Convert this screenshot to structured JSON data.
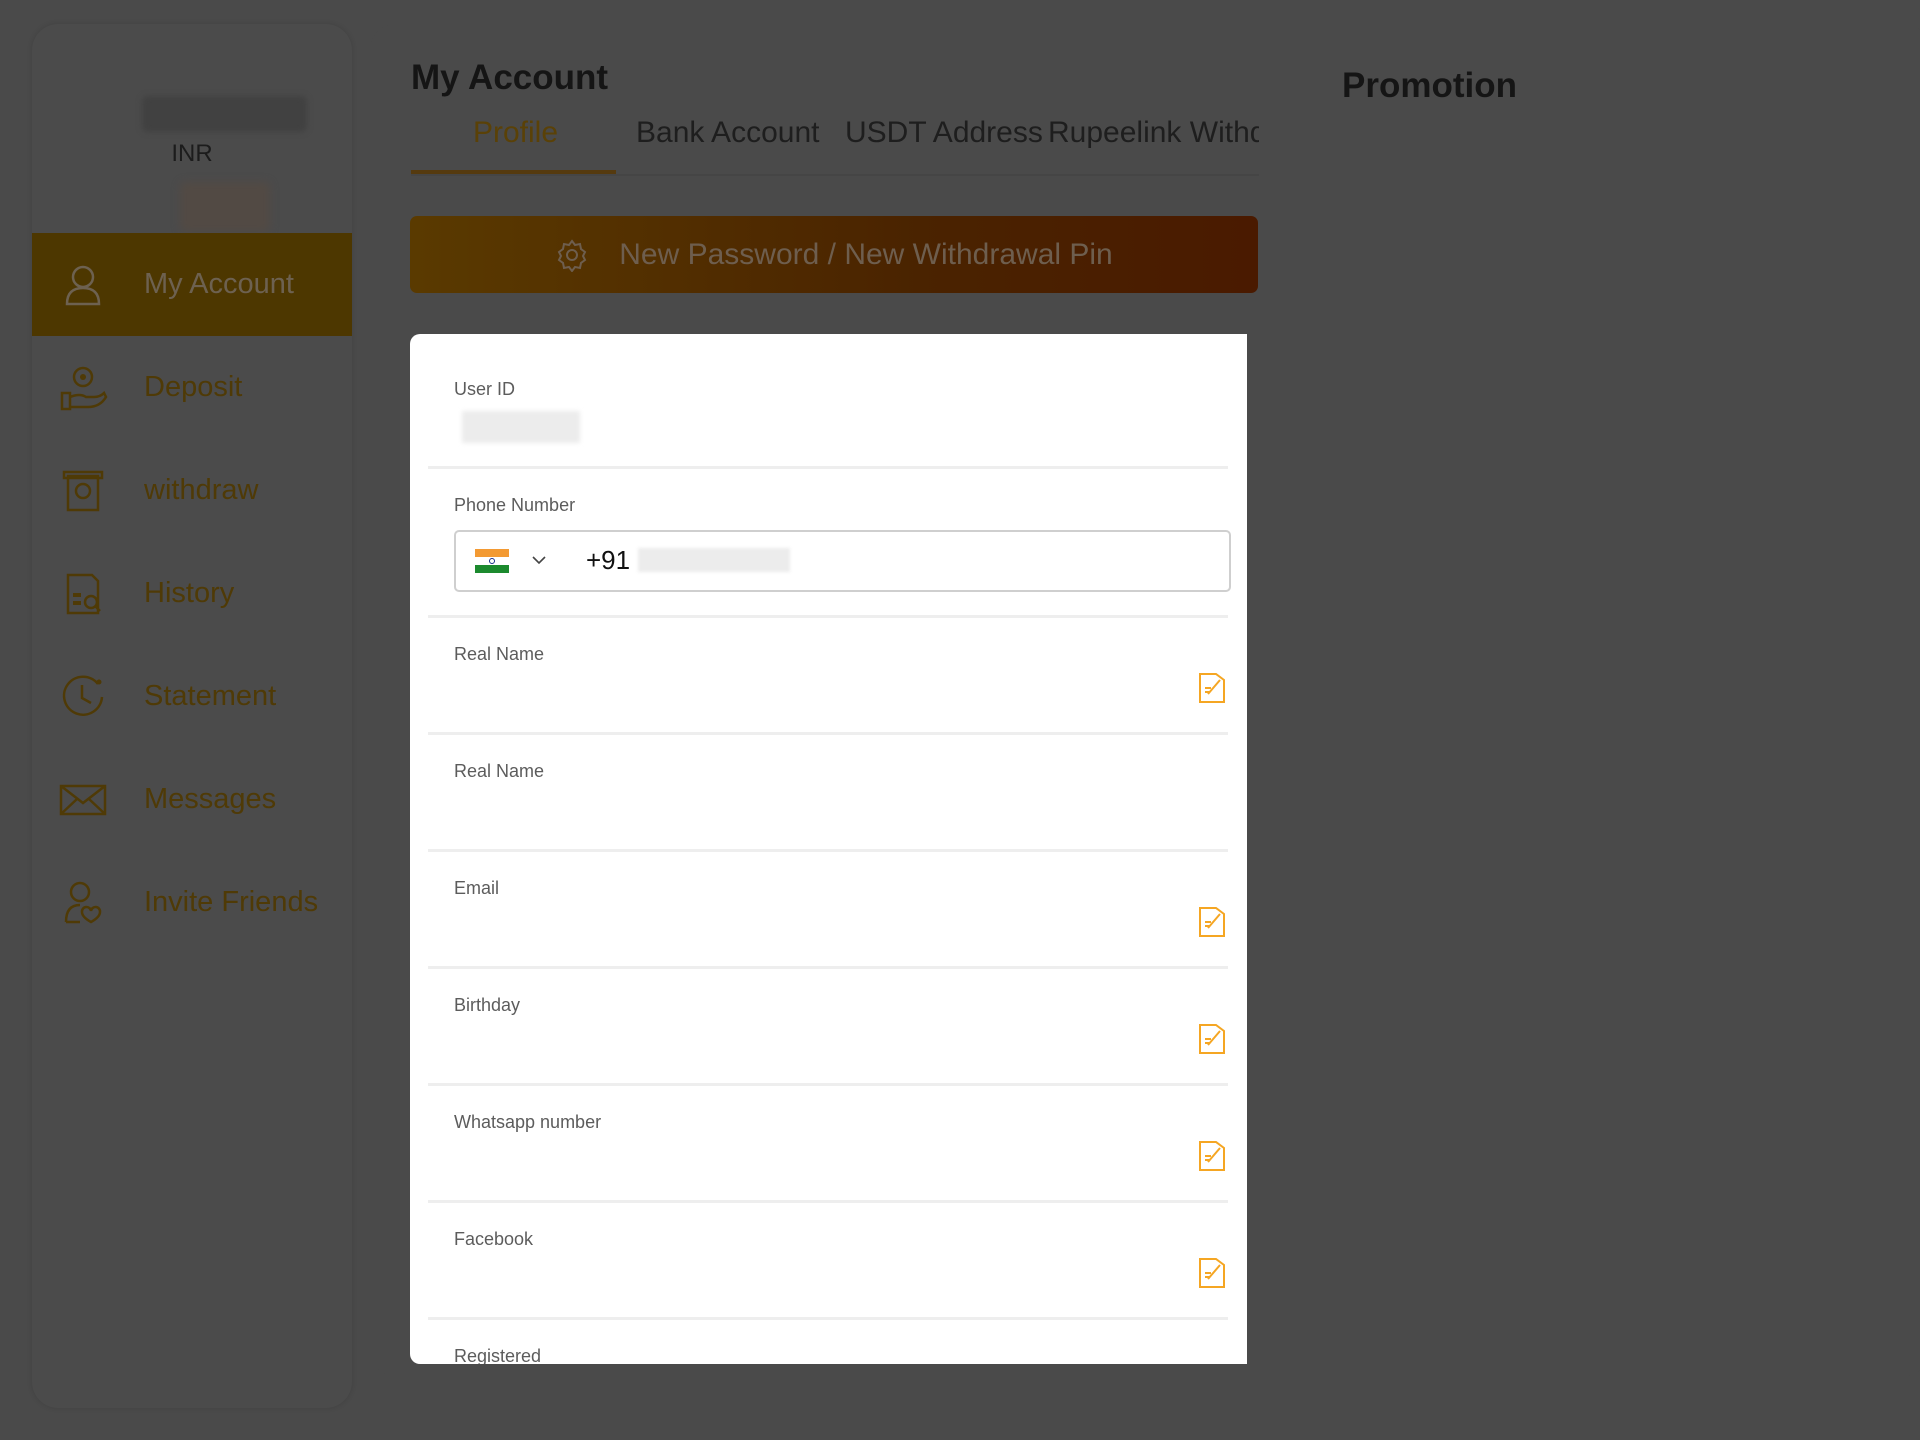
{
  "sidebar": {
    "currency": "INR",
    "items": [
      {
        "label": "My Account",
        "icon": "user-icon",
        "active": true
      },
      {
        "label": "Deposit",
        "icon": "deposit-icon",
        "active": false
      },
      {
        "label": "withdraw",
        "icon": "withdraw-icon",
        "active": false
      },
      {
        "label": "History",
        "icon": "history-icon",
        "active": false
      },
      {
        "label": "Statement",
        "icon": "clock-icon",
        "active": false
      },
      {
        "label": "Messages",
        "icon": "envelope-icon",
        "active": false
      },
      {
        "label": "Invite Friends",
        "icon": "invite-user-icon",
        "active": false
      }
    ]
  },
  "header": {
    "title": "My Account",
    "tabs": [
      {
        "label": "Profile",
        "active": true
      },
      {
        "label": "Bank Account",
        "active": false
      },
      {
        "label": "USDT Address",
        "active": false
      },
      {
        "label": "Rupeelink Withdraw",
        "active": false
      }
    ]
  },
  "password_button": {
    "label": "New Password / New Withdrawal Pin",
    "icon": "gear-icon"
  },
  "promotion": {
    "title": "Promotion"
  },
  "profile": {
    "user_id": {
      "label": "User ID"
    },
    "phone": {
      "label": "Phone Number",
      "country_code": "+91",
      "country": "India"
    },
    "fields": [
      {
        "label": "Real Name",
        "editable": true
      },
      {
        "label": "Real Name",
        "editable": false
      },
      {
        "label": "Email",
        "editable": true
      },
      {
        "label": "Birthday",
        "editable": true
      },
      {
        "label": "Whatsapp number",
        "editable": true
      },
      {
        "label": "Facebook",
        "editable": true
      },
      {
        "label": "Registered",
        "editable": false
      }
    ]
  },
  "colors": {
    "overlay_bg": "#4a4a4a",
    "accent": "#f5a623",
    "active_tab": "#f0a500"
  }
}
